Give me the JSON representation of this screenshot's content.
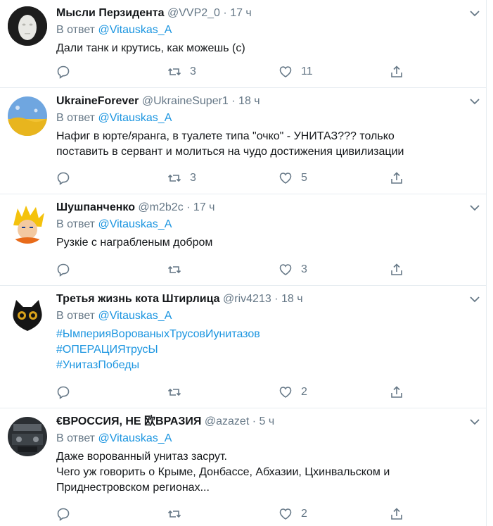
{
  "tweets": [
    {
      "name": "Мысли Перзидента",
      "handle": "@VVP2_0",
      "time": "17 ч",
      "reply_prefix": "В ответ",
      "reply_to": "@Vitauskas_A",
      "lines": [
        "Дали танк и крутись, как можешь (с)"
      ],
      "hashtags": [],
      "retweets": "3",
      "likes": "11"
    },
    {
      "name": "UkraineForever",
      "handle": "@UkraineSuper1",
      "time": "18 ч",
      "reply_prefix": "В ответ",
      "reply_to": "@Vitauskas_A",
      "lines": [
        "Нафиг в юрте/яранга, в туалете типа \"очко\" - УНИТАЗ??? только",
        "поставить в сервант и молиться на чудо достижения цивилизации"
      ],
      "hashtags": [],
      "retweets": "3",
      "likes": "5"
    },
    {
      "name": "Шушпанченко",
      "handle": "@m2b2c",
      "time": "17 ч",
      "reply_prefix": "В ответ",
      "reply_to": "@Vitauskas_A",
      "lines": [
        "Рузкіе с награбленым добром"
      ],
      "hashtags": [],
      "retweets": "",
      "likes": "3"
    },
    {
      "name": "Третья жизнь кота Штирлица",
      "handle": "@riv4213",
      "time": "18 ч",
      "reply_prefix": "В ответ",
      "reply_to": "@Vitauskas_A",
      "lines": [],
      "hashtags": [
        "#ЫмперияВорованыхТрусовИунитазов",
        "#ОПЕРАЦИЯтрусЫ",
        "#УнитазПобеды"
      ],
      "retweets": "",
      "likes": "2"
    },
    {
      "name": "€ВРОССИЯ, НЕ 欧ВРАЗИЯ",
      "handle": "@azazet",
      "time": "5 ч",
      "reply_prefix": "В ответ",
      "reply_to": "@Vitauskas_A",
      "lines": [
        "Даже ворованный унитаз засрут.",
        "Чего уж говорить о Крыме, Донбассе, Абхазии, Цхинвальском и",
        "Приднестровском регионах..."
      ],
      "hashtags": [],
      "retweets": "",
      "likes": "2"
    }
  ],
  "colors": {
    "link": "#1b95e0",
    "muted": "#657786",
    "text": "#14171a",
    "border": "#e6ecf0"
  },
  "icons": [
    "reply-icon",
    "retweet-icon",
    "like-icon",
    "share-icon",
    "caret-down-icon"
  ]
}
